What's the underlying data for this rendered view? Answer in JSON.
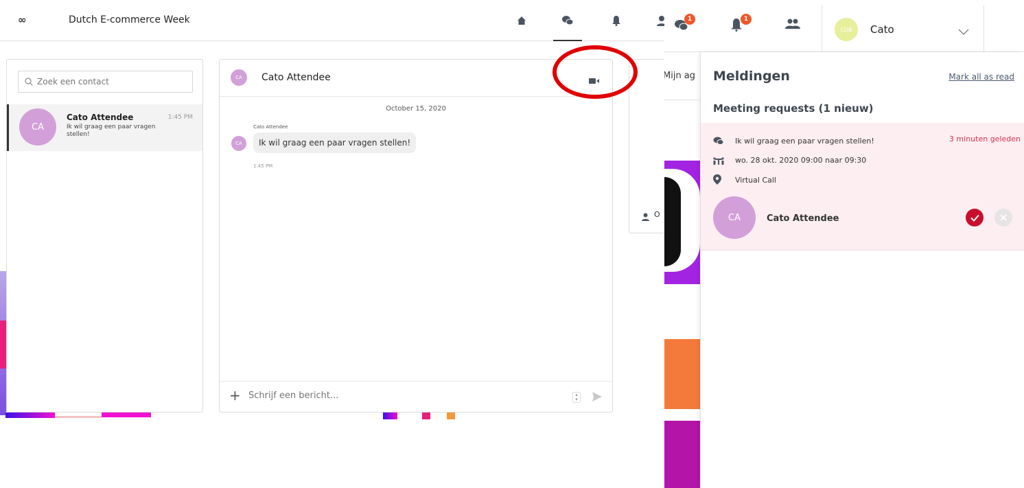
{
  "left_app": {
    "event_title": "Dutch E-commerce Week",
    "logo": "∞",
    "nav_icons": [
      "home-icon",
      "chat-icon",
      "bell-icon",
      "user-icon"
    ],
    "contacts": {
      "search_placeholder": "Zoek een contact",
      "items": [
        {
          "initials": "CA",
          "name": "Cato Attendee",
          "time": "1:45 PM",
          "preview": "Ik wil graag een paar vragen stellen!"
        }
      ]
    },
    "chat": {
      "initials": "CA",
      "name": "Cato Attendee",
      "date": "October 15, 2020",
      "sender": "Cato Attendee",
      "message": "Ik wil graag een paar vragen stellen!",
      "message_time": "1:45 PM",
      "compose_placeholder": "Schrijf een bericht..."
    },
    "side_card_text": "O"
  },
  "right_app": {
    "header": {
      "chat_badge": "1",
      "bell_badge": "1",
      "user_initials": "CDB",
      "user_name": "Cato"
    },
    "background_text": "Mijn ag",
    "notifications": {
      "title": "Meldingen",
      "mark_all": "Mark all as read",
      "section": "Meeting requests (1 nieuw)",
      "item": {
        "message": "Ik wil graag een paar vragen stellen!",
        "ago": "3 minuten geleden",
        "when": "wo. 28 okt. 2020 09:00 naar 09:30",
        "where": "Virtual Call",
        "initials": "CA",
        "name": "Cato Attendee"
      }
    }
  },
  "colors": {
    "avatar": "#d39fd9",
    "badge": "#f0582a",
    "accept": "#c8102e",
    "highlight_circle": "#e00000",
    "notification_card": "#fdeef1"
  }
}
